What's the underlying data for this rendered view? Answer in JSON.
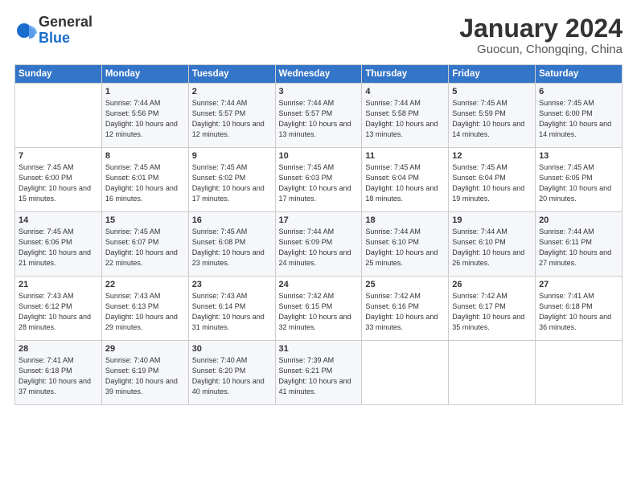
{
  "header": {
    "logo_general": "General",
    "logo_blue": "Blue",
    "month_title": "January 2024",
    "location": "Guocun, Chongqing, China"
  },
  "weekdays": [
    "Sunday",
    "Monday",
    "Tuesday",
    "Wednesday",
    "Thursday",
    "Friday",
    "Saturday"
  ],
  "weeks": [
    [
      {
        "day": "",
        "sunrise": "",
        "sunset": "",
        "daylight": ""
      },
      {
        "day": "1",
        "sunrise": "Sunrise: 7:44 AM",
        "sunset": "Sunset: 5:56 PM",
        "daylight": "Daylight: 10 hours and 12 minutes."
      },
      {
        "day": "2",
        "sunrise": "Sunrise: 7:44 AM",
        "sunset": "Sunset: 5:57 PM",
        "daylight": "Daylight: 10 hours and 12 minutes."
      },
      {
        "day": "3",
        "sunrise": "Sunrise: 7:44 AM",
        "sunset": "Sunset: 5:57 PM",
        "daylight": "Daylight: 10 hours and 13 minutes."
      },
      {
        "day": "4",
        "sunrise": "Sunrise: 7:44 AM",
        "sunset": "Sunset: 5:58 PM",
        "daylight": "Daylight: 10 hours and 13 minutes."
      },
      {
        "day": "5",
        "sunrise": "Sunrise: 7:45 AM",
        "sunset": "Sunset: 5:59 PM",
        "daylight": "Daylight: 10 hours and 14 minutes."
      },
      {
        "day": "6",
        "sunrise": "Sunrise: 7:45 AM",
        "sunset": "Sunset: 6:00 PM",
        "daylight": "Daylight: 10 hours and 14 minutes."
      }
    ],
    [
      {
        "day": "7",
        "sunrise": "Sunrise: 7:45 AM",
        "sunset": "Sunset: 6:00 PM",
        "daylight": "Daylight: 10 hours and 15 minutes."
      },
      {
        "day": "8",
        "sunrise": "Sunrise: 7:45 AM",
        "sunset": "Sunset: 6:01 PM",
        "daylight": "Daylight: 10 hours and 16 minutes."
      },
      {
        "day": "9",
        "sunrise": "Sunrise: 7:45 AM",
        "sunset": "Sunset: 6:02 PM",
        "daylight": "Daylight: 10 hours and 17 minutes."
      },
      {
        "day": "10",
        "sunrise": "Sunrise: 7:45 AM",
        "sunset": "Sunset: 6:03 PM",
        "daylight": "Daylight: 10 hours and 17 minutes."
      },
      {
        "day": "11",
        "sunrise": "Sunrise: 7:45 AM",
        "sunset": "Sunset: 6:04 PM",
        "daylight": "Daylight: 10 hours and 18 minutes."
      },
      {
        "day": "12",
        "sunrise": "Sunrise: 7:45 AM",
        "sunset": "Sunset: 6:04 PM",
        "daylight": "Daylight: 10 hours and 19 minutes."
      },
      {
        "day": "13",
        "sunrise": "Sunrise: 7:45 AM",
        "sunset": "Sunset: 6:05 PM",
        "daylight": "Daylight: 10 hours and 20 minutes."
      }
    ],
    [
      {
        "day": "14",
        "sunrise": "Sunrise: 7:45 AM",
        "sunset": "Sunset: 6:06 PM",
        "daylight": "Daylight: 10 hours and 21 minutes."
      },
      {
        "day": "15",
        "sunrise": "Sunrise: 7:45 AM",
        "sunset": "Sunset: 6:07 PM",
        "daylight": "Daylight: 10 hours and 22 minutes."
      },
      {
        "day": "16",
        "sunrise": "Sunrise: 7:45 AM",
        "sunset": "Sunset: 6:08 PM",
        "daylight": "Daylight: 10 hours and 23 minutes."
      },
      {
        "day": "17",
        "sunrise": "Sunrise: 7:44 AM",
        "sunset": "Sunset: 6:09 PM",
        "daylight": "Daylight: 10 hours and 24 minutes."
      },
      {
        "day": "18",
        "sunrise": "Sunrise: 7:44 AM",
        "sunset": "Sunset: 6:10 PM",
        "daylight": "Daylight: 10 hours and 25 minutes."
      },
      {
        "day": "19",
        "sunrise": "Sunrise: 7:44 AM",
        "sunset": "Sunset: 6:10 PM",
        "daylight": "Daylight: 10 hours and 26 minutes."
      },
      {
        "day": "20",
        "sunrise": "Sunrise: 7:44 AM",
        "sunset": "Sunset: 6:11 PM",
        "daylight": "Daylight: 10 hours and 27 minutes."
      }
    ],
    [
      {
        "day": "21",
        "sunrise": "Sunrise: 7:43 AM",
        "sunset": "Sunset: 6:12 PM",
        "daylight": "Daylight: 10 hours and 28 minutes."
      },
      {
        "day": "22",
        "sunrise": "Sunrise: 7:43 AM",
        "sunset": "Sunset: 6:13 PM",
        "daylight": "Daylight: 10 hours and 29 minutes."
      },
      {
        "day": "23",
        "sunrise": "Sunrise: 7:43 AM",
        "sunset": "Sunset: 6:14 PM",
        "daylight": "Daylight: 10 hours and 31 minutes."
      },
      {
        "day": "24",
        "sunrise": "Sunrise: 7:42 AM",
        "sunset": "Sunset: 6:15 PM",
        "daylight": "Daylight: 10 hours and 32 minutes."
      },
      {
        "day": "25",
        "sunrise": "Sunrise: 7:42 AM",
        "sunset": "Sunset: 6:16 PM",
        "daylight": "Daylight: 10 hours and 33 minutes."
      },
      {
        "day": "26",
        "sunrise": "Sunrise: 7:42 AM",
        "sunset": "Sunset: 6:17 PM",
        "daylight": "Daylight: 10 hours and 35 minutes."
      },
      {
        "day": "27",
        "sunrise": "Sunrise: 7:41 AM",
        "sunset": "Sunset: 6:18 PM",
        "daylight": "Daylight: 10 hours and 36 minutes."
      }
    ],
    [
      {
        "day": "28",
        "sunrise": "Sunrise: 7:41 AM",
        "sunset": "Sunset: 6:18 PM",
        "daylight": "Daylight: 10 hours and 37 minutes."
      },
      {
        "day": "29",
        "sunrise": "Sunrise: 7:40 AM",
        "sunset": "Sunset: 6:19 PM",
        "daylight": "Daylight: 10 hours and 39 minutes."
      },
      {
        "day": "30",
        "sunrise": "Sunrise: 7:40 AM",
        "sunset": "Sunset: 6:20 PM",
        "daylight": "Daylight: 10 hours and 40 minutes."
      },
      {
        "day": "31",
        "sunrise": "Sunrise: 7:39 AM",
        "sunset": "Sunset: 6:21 PM",
        "daylight": "Daylight: 10 hours and 41 minutes."
      },
      {
        "day": "",
        "sunrise": "",
        "sunset": "",
        "daylight": ""
      },
      {
        "day": "",
        "sunrise": "",
        "sunset": "",
        "daylight": ""
      },
      {
        "day": "",
        "sunrise": "",
        "sunset": "",
        "daylight": ""
      }
    ]
  ]
}
